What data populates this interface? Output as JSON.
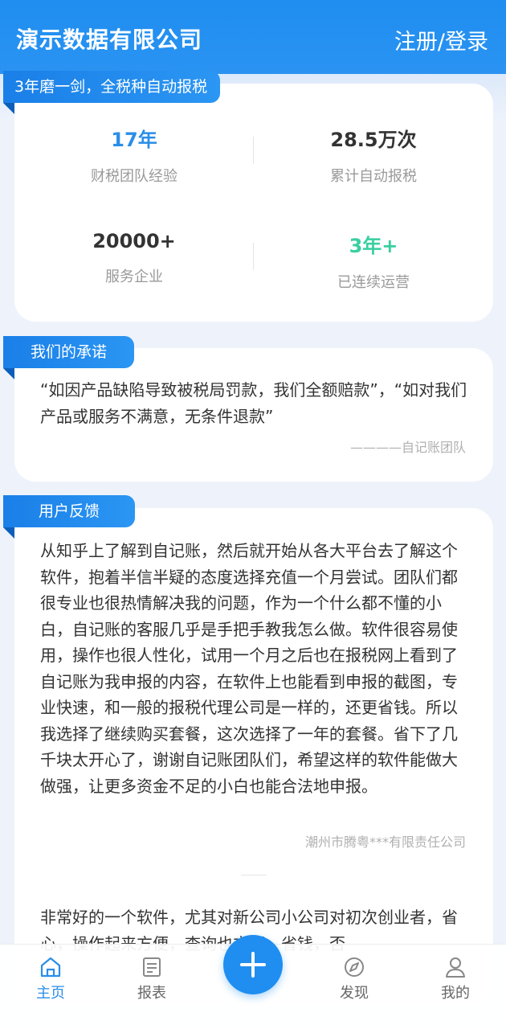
{
  "header": {
    "title": "演示数据有限公司",
    "login_label": "注册/登录"
  },
  "stats_card": {
    "ribbon": "3年磨一剑，全税种自动报税",
    "items": [
      {
        "value": "17年",
        "label": "财税团队经验",
        "color": "#2a8ee8"
      },
      {
        "value": "28.5万次",
        "label": "累计自动报税",
        "color": "#333333"
      },
      {
        "value": "20000+",
        "label": "服务企业",
        "color": "#333333"
      },
      {
        "value": "3年+",
        "label": "已连续运营",
        "color": "#38cfa0"
      }
    ]
  },
  "promise_card": {
    "ribbon": "我们的承诺",
    "quote": "“如因产品缺陷导致被税局罚款，我们全额赔款”，“如对我们产品或服务不满意，无条件退款”",
    "signature": "————自记账团队"
  },
  "feedback_card": {
    "ribbon": "用户反馈",
    "reviews": [
      {
        "text": "从知乎上了解到自记账，然后就开始从各大平台去了解这个软件，抱着半信半疑的态度选择充值一个月尝试。团队们都很专业也很热情解决我的问题，作为一个什么都不懂的小白，自记账的客服几乎是手把手教我怎么做。软件很容易使用，操作也很人性化，试用一个月之后也在报税网上看到了自记账为我申报的内容，在软件上也能看到申报的截图，专业快速，和一般的报税代理公司是一样的，还更省钱。所以我选择了继续购买套餐，这次选择了一年的套餐。省下了几千块太开心了，谢谢自记账团队们，希望这样的软件能做大做强，让更多资金不足的小白也能合法地申报。",
        "company": "潮州市腾粤***有限责任公司"
      },
      {
        "text": "非常好的一个软件，尤其对新公司小公司对初次创业者，省心，操作起来方便，查询也方便，省钱，否"
      }
    ]
  },
  "tabbar": {
    "items": [
      {
        "label": "主页",
        "icon": "home-icon",
        "active": true
      },
      {
        "label": "报表",
        "icon": "report-icon",
        "active": false
      },
      {
        "label": "发现",
        "icon": "discover-icon",
        "active": false
      },
      {
        "label": "我的",
        "icon": "profile-icon",
        "active": false
      }
    ],
    "fab_icon": "plus-icon",
    "accent": "#1f8ef0"
  }
}
